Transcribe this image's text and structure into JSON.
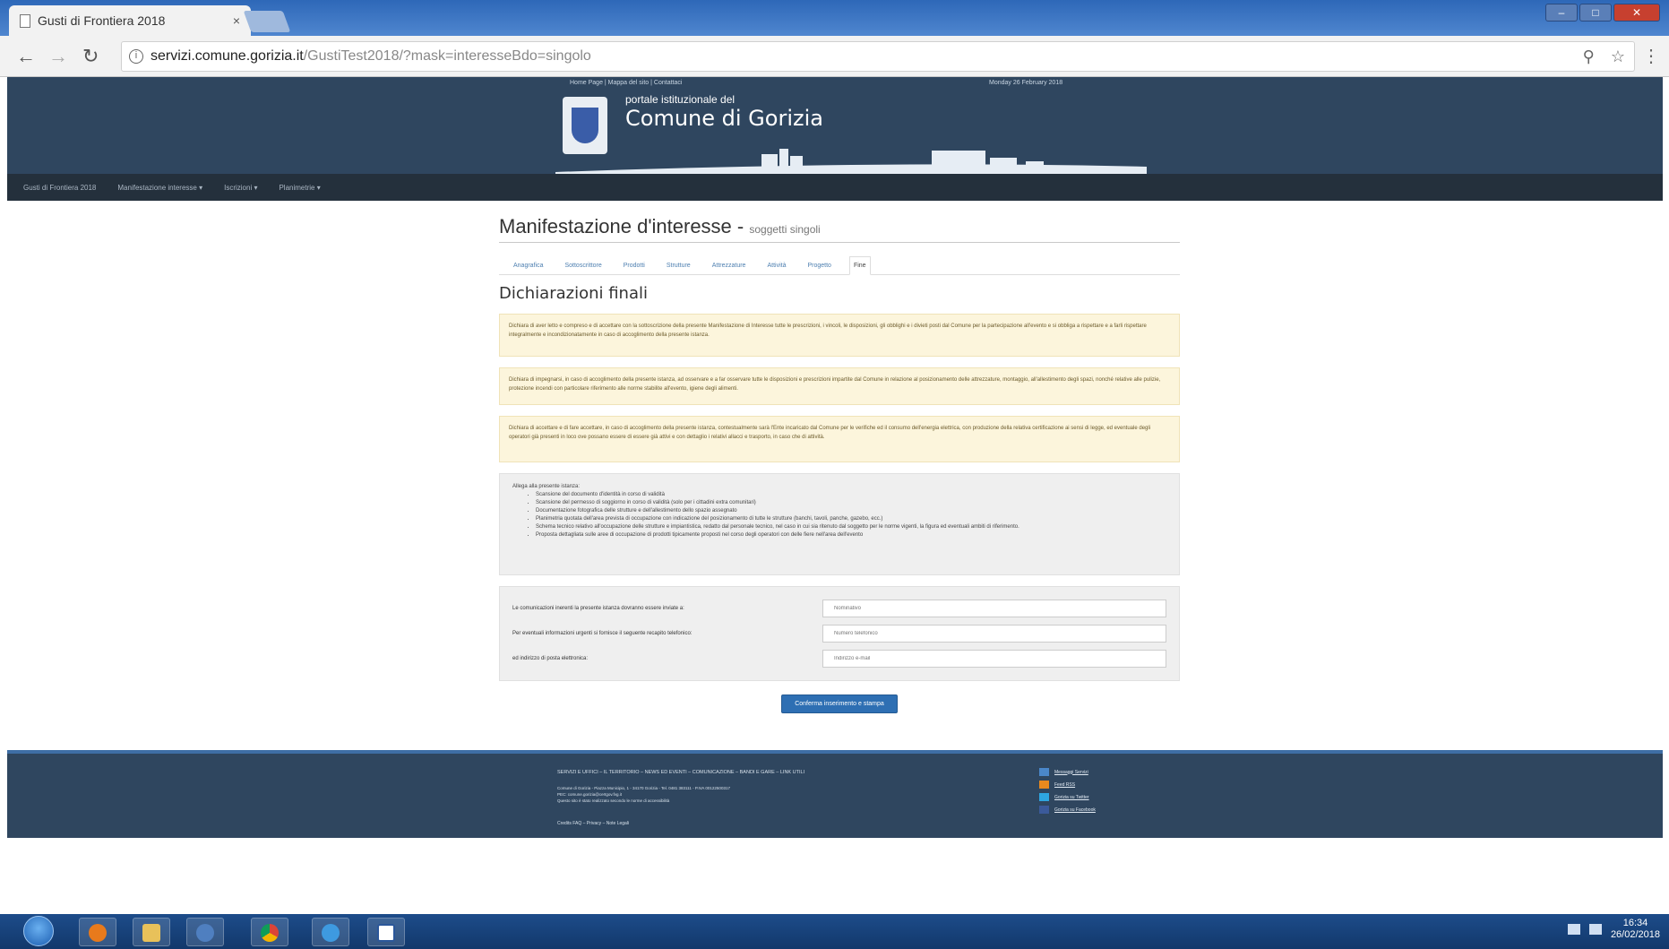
{
  "browser": {
    "tab_title": "Gusti di Frontiera 2018",
    "tab_close": "×",
    "url_host": "servizi.comune.gorizia.it",
    "url_path": "/GustiTest2018/?mask=interesseBdo=singolo",
    "window_controls": [
      "–",
      "□",
      "✕"
    ]
  },
  "site": {
    "utility_links": "Home Page  |  Mappa del sito  |  Contattaci",
    "date": "Monday 26 February 2018",
    "portal_label": "portale istituzionale del",
    "city_name": "Comune di Gorizia",
    "main_nav": [
      "Gusti di Frontiera 2018",
      "Manifestazione interesse ▾",
      "Iscrizioni ▾",
      "Planimetrie ▾"
    ]
  },
  "page": {
    "title": "Manifestazione d'interesse - ",
    "subtitle": "soggetti singoli",
    "tabs": [
      "Anagrafica",
      "Sottoscrittore",
      "Prodotti",
      "Strutture",
      "Attrezzature",
      "Attività",
      "Progetto",
      "Fine"
    ],
    "active_tab": "Fine",
    "section_title": "Dichiarazioni finali",
    "warning_1": "Dichiara di aver letto e compreso e di accettare con la sottoscrizione della presente Manifestazione di Interesse tutte le prescrizioni, i vincoli, le disposizioni, gli obblighi e i divieti posti dal Comune per la partecipazione all'evento e si obbliga a rispettare e a farli rispettare integralmente e incondizionatamente in caso di accoglimento della presente istanza.",
    "warning_2": "Dichiara di impegnarsi, in caso di accoglimento della presente istanza, ad osservare e a far osservare tutte le disposizioni e prescrizioni impartite dal Comune in relazione al posizionamento delle attrezzature, montaggio, all'allestimento degli spazi, nonché relative alle pulizie, protezione incendi con particolare riferimento alle norme stabilite all'evento, igiene degli alimenti.",
    "warning_3": "Dichiara di accettare e di fare accettare, in caso di accoglimento della presente istanza, contestualmente sarà l'Ente incaricato dal Comune per le verifiche ed il consumo dell'energia elettrica, con produzione della relativa certificazione ai sensi di legge, ed eventuale degli operatori già presenti in loco ove possano essere di essere già attivi e con dettaglio i relativi allacci e trasporto, in caso che di attività.",
    "annex_title": "Allega alla presente istanza:",
    "annex_items": [
      "Scansione del documento d'identità in corso di validità",
      "Scansione del permesso di soggiorno in corso di validità (solo per i cittadini extra comunitari)",
      "Documentazione fotografica delle strutture e dell'allestimento dello spazio assegnato",
      "Planimetria quotata dell'area prevista di occupazione con indicazione del posizionamento di tutte le strutture (banchi, tavoli, panche, gazebo, ecc.)",
      "Schema tecnico relativo all'occupazione delle strutture e impiantistica, redatto dal personale tecnico, nel caso in cui sia ritenuto dal soggetto per le norme vigenti, la figura ed eventuali ambiti di riferimento.",
      "Proposta dettagliata sulle aree di occupazione di prodotti tipicamente proposti nel corso degli operatori con delle fiere nell'area dell'evento"
    ],
    "form": {
      "contact_label": "Le comunicazioni inerenti la presente istanza dovranno essere inviate a:",
      "contact_placeholder": "Nominativo",
      "phone_label": "Per eventuali informazioni urgenti si fornisce il seguente recapito telefonico:",
      "phone_placeholder": "Numero telefonico",
      "email_label": "ed indirizzo di posta elettronica:",
      "email_placeholder": "Indirizzo e-mail"
    },
    "submit_label": "Conferma inserimento e stampa"
  },
  "footer": {
    "links": "SERVIZI E UFFICI  –  IL TERRITORIO  –  NEWS ED EVENTI  –  COMUNICAZIONE  –  BANDI E GARE  –  LINK UTILI",
    "address_1": "Comune di Gorizia - Piazza Municipio, 1 - 34170 Gorizia - Tel. 0481 383111 - P.IVA 00122500317",
    "address_2": "PEC: comune.gorizia@certgov.fvg.it",
    "address_3": "Questo sito è stato realizzato secondo le norme di accessibilità",
    "credits": "Credits FAQ  –  Privacy  –  Note Legali",
    "social": [
      "Messaggi Servizi",
      "Feed RSS",
      "Gorizia su Twitter",
      "Gorizia su Facebook"
    ]
  },
  "taskbar": {
    "time": "16:34",
    "date": "26/02/2018"
  },
  "colors": {
    "header_bg": "#2f465f",
    "nav_bg": "#24303c",
    "warning_bg": "#fcf5dc",
    "button_bg": "#2e6fb3",
    "taskbar_bg": "#1d4c8a"
  }
}
